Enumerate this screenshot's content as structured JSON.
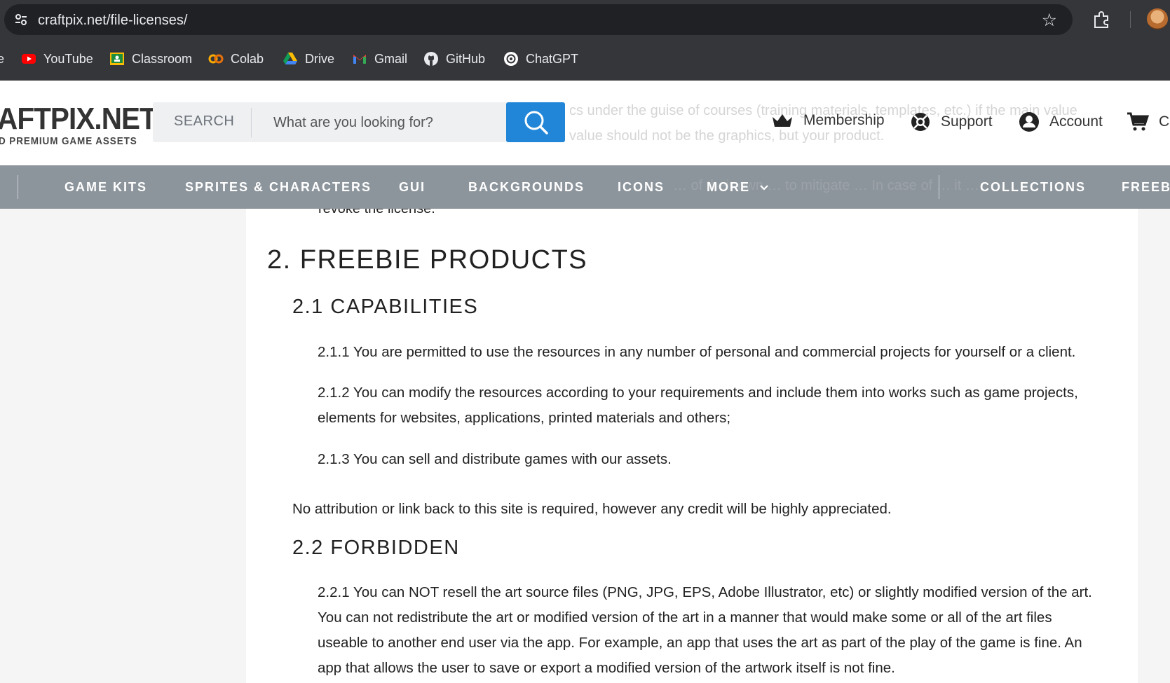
{
  "browser": {
    "url": "craftpix.net/file-licenses/",
    "bookmarks": [
      {
        "label": "YouTube",
        "icon": "youtube-icon"
      },
      {
        "label": "Classroom",
        "icon": "classroom-icon"
      },
      {
        "label": "Colab",
        "icon": "colab-icon"
      },
      {
        "label": "Drive",
        "icon": "drive-icon"
      },
      {
        "label": "Gmail",
        "icon": "gmail-icon"
      },
      {
        "label": "GitHub",
        "icon": "github-icon"
      },
      {
        "label": "ChatGPT",
        "icon": "chatgpt-icon"
      }
    ],
    "partial_bookmark": "e"
  },
  "header": {
    "logo_main": "AFTPIX.NET",
    "logo_sub": "D PREMIUM GAME ASSETS",
    "search_label": "SEARCH",
    "search_placeholder": "What are you looking for?",
    "membership": "Membership",
    "support": "Support",
    "account": "Account",
    "cart": "Ca",
    "ghost_line1": "cs under the guise of courses (training materials, templates, etc.) if the main value",
    "ghost_line2": "value should not be the graphics, but your product."
  },
  "nav": {
    "items": [
      "GAME KITS",
      "SPRITES & CHARACTERS",
      "GUI",
      "BACKGROUNDS",
      "ICONS",
      "MORE",
      "COLLECTIONS",
      "FREEBI"
    ],
    "ghost_text": "… of their own … to mitigate … In case of … it …"
  },
  "content": {
    "revoke_fragment": "revoke the license.",
    "section_title": "2. FREEBIE PRODUCTS",
    "capabilities_title": "2.1 CAPABILITIES",
    "cap_1": "2.1.1 You are permitted to use the resources in any number of personal and commercial projects for yourself or a client.",
    "cap_2a": "2.1.2 You can modify the resources according to your requirements and include them into works such as game projects,",
    "cap_2b": "elements for websites, applications, printed materials and others;",
    "cap_3": "2.1.3 You can sell and distribute games with our assets.",
    "attribution": "No attribution or link back to this site is required, however any credit will be highly appreciated.",
    "forbidden_title": "2.2 FORBIDDEN",
    "forb_1a": "2.2.1 You can NOT resell the art source files (PNG, JPG, EPS, Adobe Illustrator, etc) or slightly modified version of the art.",
    "forb_1b": "You can not redistribute the art or modified version of the art in a manner that would make some or all of the art files",
    "forb_1c": "useable to another end user via the app. For example, an app that uses the art as part of the play of the game is fine. An",
    "forb_1d": "app that allows the user to save or export a modified version of the artwork itself is not fine."
  },
  "colors": {
    "chrome_bg": "#35363a",
    "omnibox_bg": "#202124",
    "nav_bg": "#8d959c",
    "search_button": "#2186d8"
  }
}
